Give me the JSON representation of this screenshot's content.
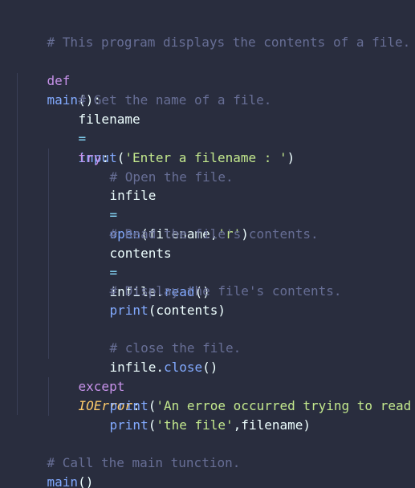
{
  "theme": {
    "background": "#292d3e",
    "comment": "#676e95",
    "keyword": "#c792ea",
    "function": "#82aaff",
    "string": "#c3e88d",
    "operator": "#89ddff",
    "text": "#eeffff",
    "class": "#ffcb6b"
  },
  "code": {
    "l1_comment": "# This program displays the contents of a file.",
    "l3_def": "def",
    "l3_name": "main",
    "l3_tail": "():",
    "l4_comment": "# Get the name of a file.",
    "l5_var": "filename",
    "l5_eq": "=",
    "l5_func": "input",
    "l5_open": "(",
    "l5_str": "'Enter a filename : '",
    "l5_close": ")",
    "l7_try": "try",
    "l7_colon": ":",
    "l8_comment": "# Open the file.",
    "l9_var": "infile",
    "l9_eq": "=",
    "l9_func": "open",
    "l9_args_a": "(filename,",
    "l9_str": "'r'",
    "l9_close": ")",
    "l11_comment": "# Read the file's contents.",
    "l12_var": "contents",
    "l12_eq": "=",
    "l12_obj": "infile.",
    "l12_method": "read",
    "l12_parens": "()",
    "l14_comment": "# Display the file's contents.",
    "l15_func": "print",
    "l15_args": "(contents)",
    "l17_comment": "# close the file.",
    "l18_obj": "infile.",
    "l18_method": "close",
    "l18_parens": "()",
    "l19_except": "except",
    "l19_class": "IOError",
    "l19_colon": ":",
    "l20_func": "print",
    "l20_open": "(",
    "l20_str": "'An erroe occurred trying to read '",
    "l20_close": ")",
    "l21_func": "print",
    "l21_open": "(",
    "l21_str": "'the file'",
    "l21_args": ",filename)",
    "l23_comment": "# Call the main tunction.",
    "l24_func": "main",
    "l24_parens": "()"
  }
}
